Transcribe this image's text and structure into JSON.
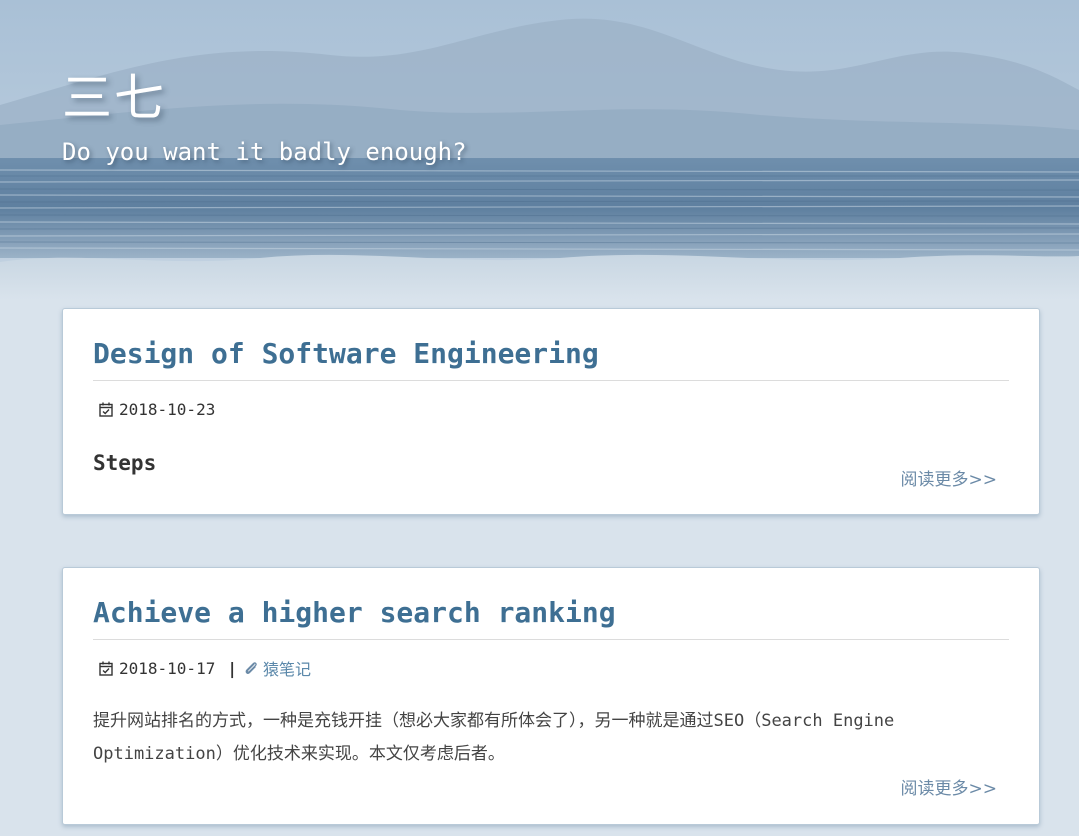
{
  "site": {
    "title": "三七",
    "subtitle": "Do you want it badly enough?"
  },
  "posts": [
    {
      "title": "Design of Software Engineering",
      "date": "2018-10-23",
      "heading": "Steps",
      "read_more": "阅读更多>>"
    },
    {
      "title": "Achieve a higher search ranking",
      "date": "2018-10-17",
      "separator": "|",
      "category": "猿笔记",
      "excerpt": "提升网站排名的方式，一种是充钱开挂（想必大家都有所体会了），另一种就是通过SEO（Search Engine Optimization）优化技术来实现。本文仅考虑后者。",
      "read_more": "阅读更多>>"
    }
  ],
  "icons": {
    "calendar": "calendar-icon",
    "category": "paperclip-icon"
  },
  "colors": {
    "title": "#3e6f93",
    "link": "#6b8aa7",
    "background": "#d9e3ec"
  }
}
